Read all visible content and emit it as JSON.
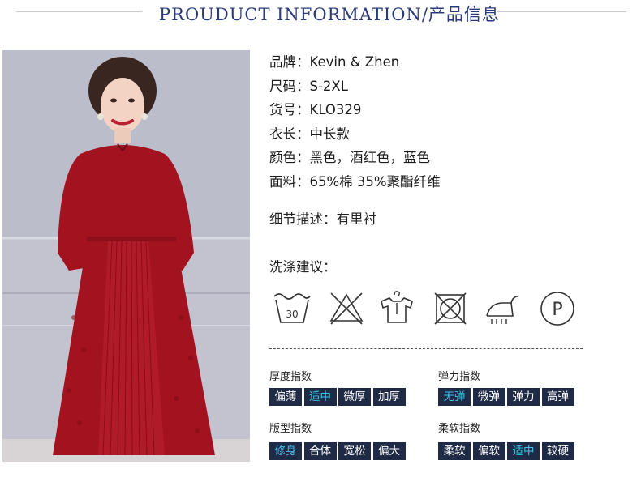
{
  "header": {
    "title": "PROUDUCT INFORMATION/产品信息"
  },
  "specs": [
    {
      "label": "品牌：",
      "value": "Kevin & Zhen"
    },
    {
      "label": "尺码：",
      "value": "S-2XL"
    },
    {
      "label": "货号：",
      "value": "KLO329"
    },
    {
      "label": "衣长：",
      "value": "中长款"
    },
    {
      "label": "颜色：",
      "value": "黑色，酒红色，蓝色"
    },
    {
      "label": "面料：",
      "value": "65%棉 35%聚酯纤维"
    }
  ],
  "detail": {
    "label": "细节描述：",
    "value": "有里衬"
  },
  "washing": {
    "title": "洗涤建议：",
    "icons": [
      "wash-30-icon",
      "no-bleach-icon",
      "hang-dry-icon",
      "no-tumble-dry-icon",
      "iron-steam-icon",
      "dry-clean-p-icon"
    ],
    "wash_temp": "30",
    "dry_clean_letter": "P"
  },
  "indices": {
    "thickness": {
      "title": "厚度指数",
      "options": [
        "偏薄",
        "适中",
        "微厚",
        "加厚"
      ],
      "selected": 1
    },
    "elasticity": {
      "title": "弹力指数",
      "options": [
        "无弹",
        "微弹",
        "弹力",
        "高弹"
      ],
      "selected": 0
    },
    "fit": {
      "title": "版型指数",
      "options": [
        "修身",
        "合体",
        "宽松",
        "偏大"
      ],
      "selected": 0
    },
    "softness": {
      "title": "柔软指数",
      "options": [
        "柔软",
        "偏软",
        "适中",
        "较硬"
      ],
      "selected": 2
    }
  },
  "colors": {
    "header_text": "#2b3a7a",
    "chip_bg": "#1f2b46",
    "chip_active_text": "#3ec2e8",
    "dress_red": "#a3121f"
  }
}
